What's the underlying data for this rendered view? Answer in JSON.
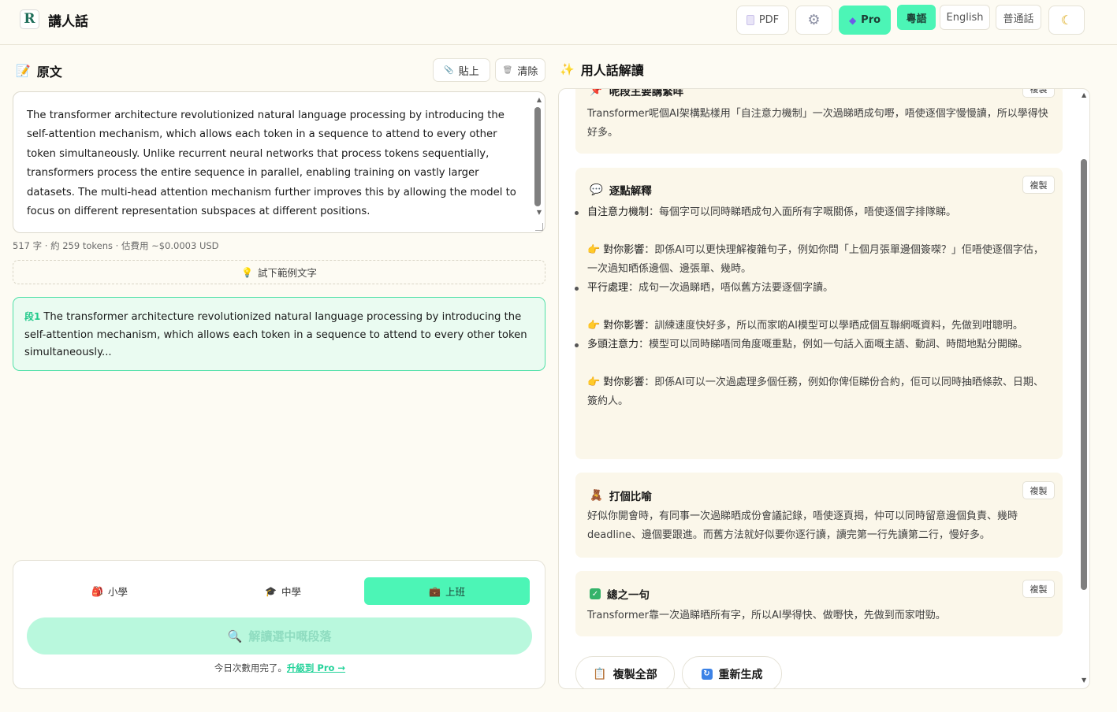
{
  "header": {
    "logo_letter": "R",
    "app_title": "講人話",
    "pdf_label": "PDF",
    "pro_label": "Pro",
    "languages": [
      "粵語",
      "English",
      "普通話"
    ],
    "active_language": "粵語"
  },
  "left": {
    "title": "原文",
    "paste_label": "貼上",
    "clear_label": "清除",
    "input_text": "The transformer architecture revolutionized natural language processing by introducing the self-attention mechanism, which allows each token in a sequence to attend to every other token simultaneously. Unlike recurrent neural networks that process tokens sequentially, transformers process the entire sequence in parallel, enabling training on vastly larger datasets. The multi-head attention mechanism further improves this by allowing the model to focus on different representation subspaces at different positions.",
    "stats": "517 字 · 約 259 tokens · 估費用 ~$0.0003 USD",
    "example_label": "試下範例文字",
    "segment": {
      "tag": "段1",
      "text": "The transformer architecture revolutionized natural language processing by introducing the self-attention mechanism, which allows each token in a sequence to attend to every other token simultaneously..."
    },
    "levels": [
      "小學",
      "中學",
      "上班"
    ],
    "active_level": "上班",
    "explain_label": "解讀選中嘅段落",
    "quota_text": "今日次數用完了。",
    "upgrade_link": "升級到 Pro →"
  },
  "right": {
    "title": "用人話解讀",
    "copy_label": "複製",
    "summary": {
      "heading": "呢段主要講緊咩",
      "body": "Transformer呢個AI架構點樣用「自注意力機制」一次過睇晒成句嘢，唔使逐個字慢慢讀，所以學得快好多。"
    },
    "points": {
      "heading": "逐點解釋",
      "items": [
        {
          "term": "自注意力機制",
          "desc": "：每個字可以同時睇晒成句入面所有字嘅關係，唔使逐個字排隊睇。",
          "impact_label": "對你影響",
          "impact": "：即係AI可以更快理解複雜句子，例如你問「上個月張單邊個簽㗎？」佢唔使逐個字估，一次過知晒係邊個、邊張單、幾時。"
        },
        {
          "term": "平行處理",
          "desc": "：成句一次過睇晒，唔似舊方法要逐個字讀。",
          "impact_label": "對你影響",
          "impact": "：訓練速度快好多，所以而家啲AI模型可以學晒成個互聯網嘅資料，先做到咁聰明。"
        },
        {
          "term": "多頭注意力",
          "desc": "：模型可以同時睇唔同角度嘅重點，例如一句話入面嘅主語、動詞、時間地點分開睇。",
          "impact_label": "對你影響",
          "impact": "：即係AI可以一次過處理多個任務，例如你俾佢睇份合約，佢可以同時抽晒條款、日期、簽約人。"
        }
      ]
    },
    "analogy": {
      "heading": "打個比喻",
      "body": "好似你開會時，有同事一次過睇晒成份會議記錄，唔使逐頁揭，仲可以同時留意邊個負責、幾時deadline、邊個要跟進。而舊方法就好似要你逐行讀，讀完第一行先讀第二行，慢好多。"
    },
    "conclusion": {
      "heading": "總之一句",
      "body": "Transformer靠一次過睇晒所有字，所以AI學得快、做嘢快，先做到而家咁勁。"
    },
    "copy_all_label": "複製全部",
    "regenerate_label": "重新生成"
  },
  "colors": {
    "accent": "#4cf5b6",
    "background": "#fdfbf3",
    "card": "#fbf7ea"
  }
}
